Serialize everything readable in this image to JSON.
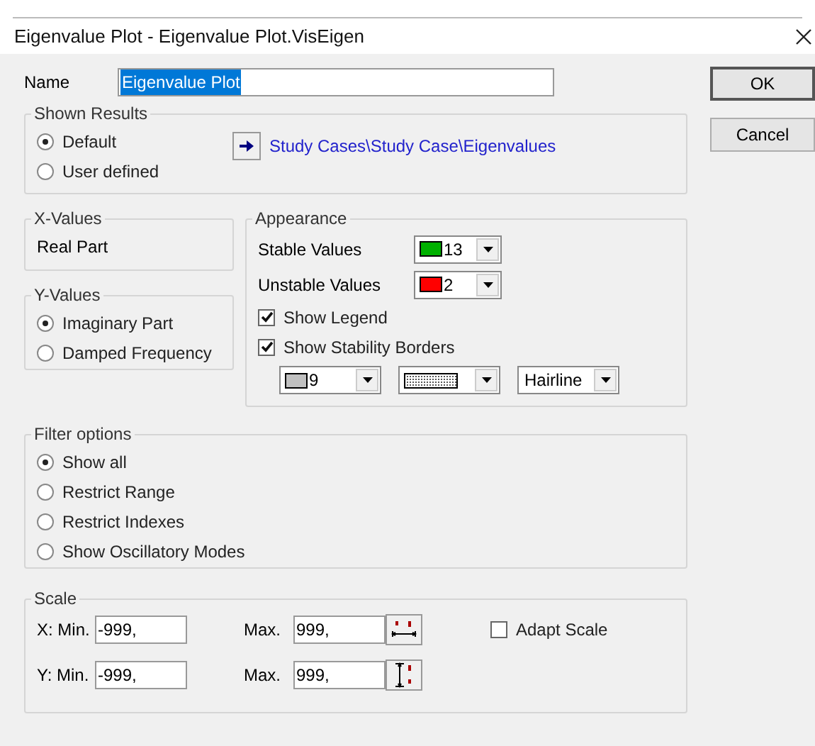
{
  "window": {
    "title": "Eigenvalue Plot - Eigenvalue Plot.VisEigen"
  },
  "name": {
    "label": "Name",
    "value": "Eigenvalue Plot",
    "selected": true
  },
  "buttons": [
    "OK",
    "Cancel"
  ],
  "shown_results": {
    "title": "Shown Results",
    "options": [
      {
        "label": "Default",
        "selected": true
      },
      {
        "label": "User defined",
        "selected": false
      }
    ],
    "link": "Study Cases\\Study Case\\Eigenvalues"
  },
  "x_values": {
    "title": "X-Values",
    "value": "Real Part"
  },
  "y_values": {
    "title": "Y-Values",
    "options": [
      {
        "label": "Imaginary Part",
        "selected": true
      },
      {
        "label": "Damped Frequency",
        "selected": false
      }
    ]
  },
  "appearance": {
    "title": "Appearance",
    "colors": [
      {
        "label": "Stable Values",
        "value": "13",
        "color": "#00b000"
      },
      {
        "label": "Unstable Values",
        "value": "2",
        "color": "#ff0000"
      }
    ],
    "checks": [
      {
        "label": "Show Legend",
        "checked": true
      },
      {
        "label": "Show Stability Borders",
        "checked": true
      }
    ],
    "border_color": {
      "value": "9",
      "color": "#c0c0c0"
    },
    "line_width": "Hairline"
  },
  "filter": {
    "title": "Filter options",
    "options": [
      {
        "label": "Show all",
        "selected": true
      },
      {
        "label": "Restrict Range",
        "selected": false
      },
      {
        "label": "Restrict Indexes",
        "selected": false
      },
      {
        "label": "Show Oscillatory Modes",
        "selected": false
      }
    ]
  },
  "scale": {
    "title": "Scale",
    "rows": [
      {
        "kind": "x",
        "label": "X: Min.",
        "min": "-999,",
        "max_label": "Max.",
        "max": "999,"
      },
      {
        "kind": "y",
        "label": "Y: Min.",
        "min": "-999,",
        "max_label": "Max.",
        "max": "999,"
      }
    ],
    "adapt": {
      "label": "Adapt Scale",
      "checked": false
    }
  }
}
